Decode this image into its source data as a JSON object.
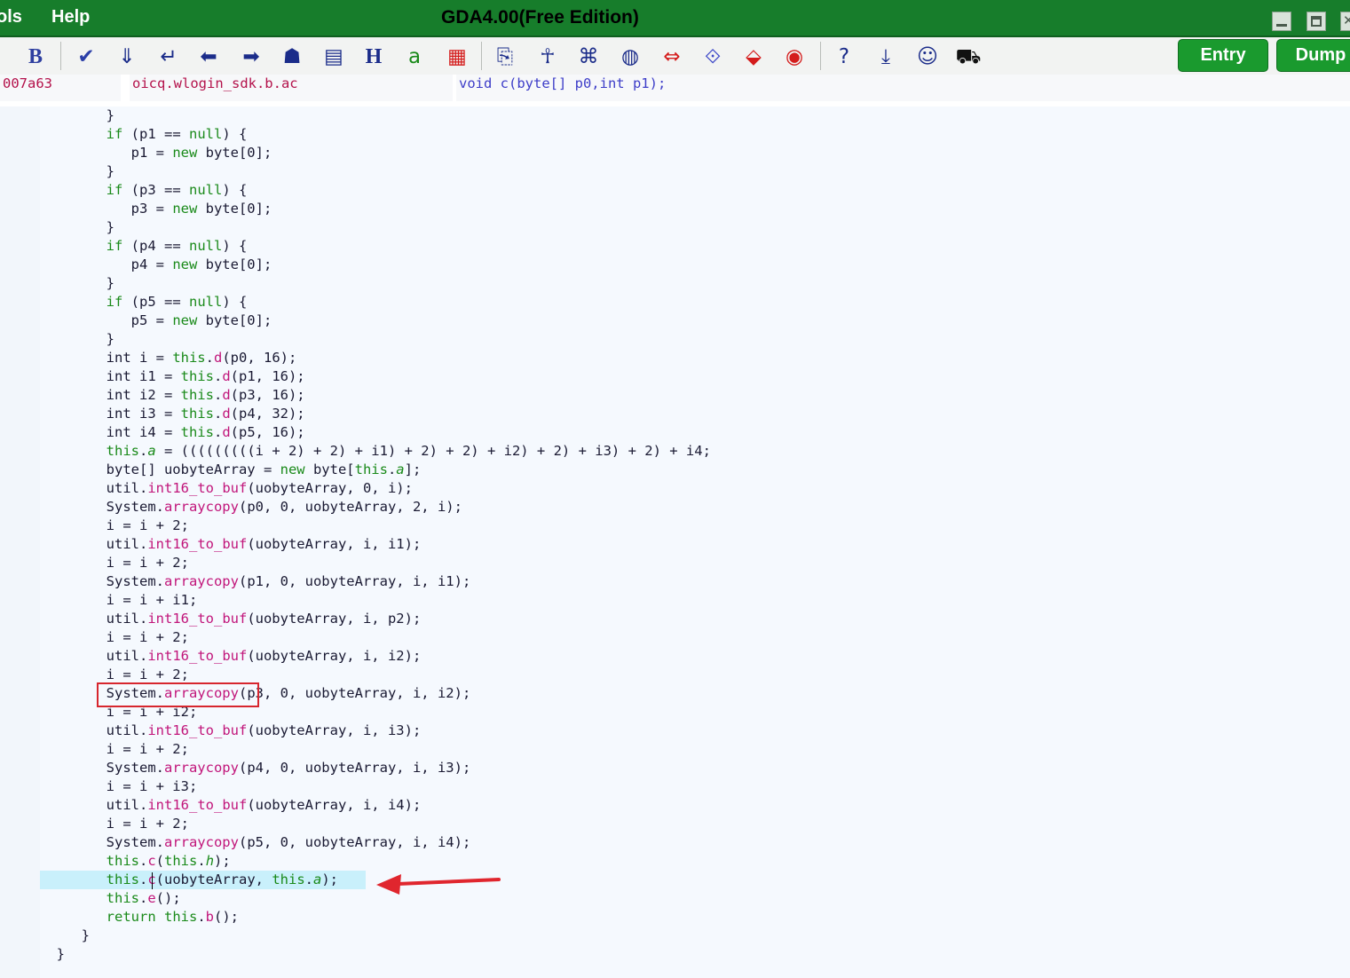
{
  "menu": {
    "tools": "ols",
    "help": "Help"
  },
  "app_title": "GDA4.00(Free Edition)",
  "toolbar": {
    "icons": [
      {
        "name": "bold-icon",
        "glyph": "B",
        "color": "#2e3fa0"
      },
      {
        "name": "checkmark-icon",
        "glyph": "✔",
        "color": "#2b3fa8"
      },
      {
        "name": "download-mark-icon",
        "glyph": "⇓",
        "color": "#1b2c8a"
      },
      {
        "name": "return-arrow-icon",
        "glyph": "↵",
        "color": "#1b2c8a"
      },
      {
        "name": "arrow-left-icon",
        "glyph": "⬅",
        "color": "#1b2c8a"
      },
      {
        "name": "arrow-right-icon",
        "glyph": "➡",
        "color": "#1b2c8a"
      },
      {
        "name": "robot-icon",
        "glyph": "☗",
        "color": "#1b2c8a"
      },
      {
        "name": "document-search-icon",
        "glyph": "▤",
        "color": "#1b2c8a"
      },
      {
        "name": "header-icon",
        "glyph": "H",
        "color": "#1b2c8a"
      },
      {
        "name": "font-color-icon",
        "glyph": "a",
        "color": "#1a8a1a"
      },
      {
        "name": "color-grid-icon",
        "glyph": "▦",
        "color": "#d41c1c"
      },
      {
        "name": "xml-document-icon",
        "glyph": "⎘",
        "color": "#1b2c8a"
      },
      {
        "name": "android-icon",
        "glyph": "☥",
        "color": "#1b2c8a"
      },
      {
        "name": "command-key-icon",
        "glyph": "⌘",
        "color": "#1b2c8a"
      },
      {
        "name": "binary-toggle-icon",
        "glyph": "◍",
        "color": "#1b2c8a"
      },
      {
        "name": "swap-arrows-icon",
        "glyph": "⇔",
        "color": "#d41c1c"
      },
      {
        "name": "chain-icon",
        "glyph": "⟐",
        "color": "#3d48c8"
      },
      {
        "name": "branch-down-icon",
        "glyph": "⬙",
        "color": "#d41c1c"
      },
      {
        "name": "fingerprint-icon",
        "glyph": "◉",
        "color": "#d41c1c"
      },
      {
        "name": "help-question-icon",
        "glyph": "?",
        "color": "#1b2c8a"
      },
      {
        "name": "download-icon",
        "glyph": "⤓",
        "color": "#1b2c8a"
      },
      {
        "name": "users-icon",
        "glyph": "☺",
        "color": "#1b2c8a"
      },
      {
        "name": "cart-icon",
        "glyph": "⛟",
        "color": "#111111"
      }
    ],
    "entry_label": "Entry",
    "dump_label": "Dump"
  },
  "info": {
    "address": "007a63",
    "class_name": "oicq.wlogin_sdk.b.ac",
    "method_signature": "void c(byte[] p0,int p1);"
  },
  "code_lines": [
    "        }",
    "        if (p1 == null) {",
    "           p1 = new byte[0];",
    "        }",
    "        if (p3 == null) {",
    "           p3 = new byte[0];",
    "        }",
    "        if (p4 == null) {",
    "           p4 = new byte[0];",
    "        }",
    "        if (p5 == null) {",
    "           p5 = new byte[0];",
    "        }",
    "        int i = this.d(p0, 16);",
    "        int i1 = this.d(p1, 16);",
    "        int i2 = this.d(p3, 16);",
    "        int i3 = this.d(p4, 32);",
    "        int i4 = this.d(p5, 16);",
    "        this.a = (((((((((i + 2) + 2) + i1) + 2) + 2) + i2) + 2) + i3) + 2) + i4;",
    "        byte[] uobyteArray = new byte[this.a];",
    "        util.int16_to_buf(uobyteArray, 0, i);",
    "        System.arraycopy(p0, 0, uobyteArray, 2, i);",
    "        i = i + 2;",
    "        util.int16_to_buf(uobyteArray, i, i1);",
    "        i = i + 2;",
    "        System.arraycopy(p1, 0, uobyteArray, i, i1);",
    "        i = i + i1;",
    "        util.int16_to_buf(uobyteArray, i, p2);",
    "        i = i + 2;",
    "        util.int16_to_buf(uobyteArray, i, i2);",
    "        i = i + 2;",
    "        System.arraycopy(p3, 0, uobyteArray, i, i2);",
    "        i = i + i2;",
    "        util.int16_to_buf(uobyteArray, i, i3);",
    "        i = i + 2;",
    "        System.arraycopy(p4, 0, uobyteArray, i, i3);",
    "        i = i + i3;",
    "        util.int16_to_buf(uobyteArray, i, i4);",
    "        i = i + 2;",
    "        System.arraycopy(p5, 0, uobyteArray, i, i4);",
    "        this.c(this.h);",
    "        this.c(uobyteArray, this.a);",
    "        this.e();",
    "        return this.b();",
    "     }",
    "  }"
  ],
  "highlight": {
    "current_line_index": 41,
    "boxed_line_index": 31,
    "box_color": "#d7262e",
    "arrow_color": "#e0262e"
  },
  "colors": {
    "title_bar": "#177d2b",
    "button_green": "#1a9a2e",
    "keyword": "#1a8a1a",
    "method": "#c1157a",
    "class_text": "#b4124b",
    "signature_text": "#3d3dc8"
  }
}
